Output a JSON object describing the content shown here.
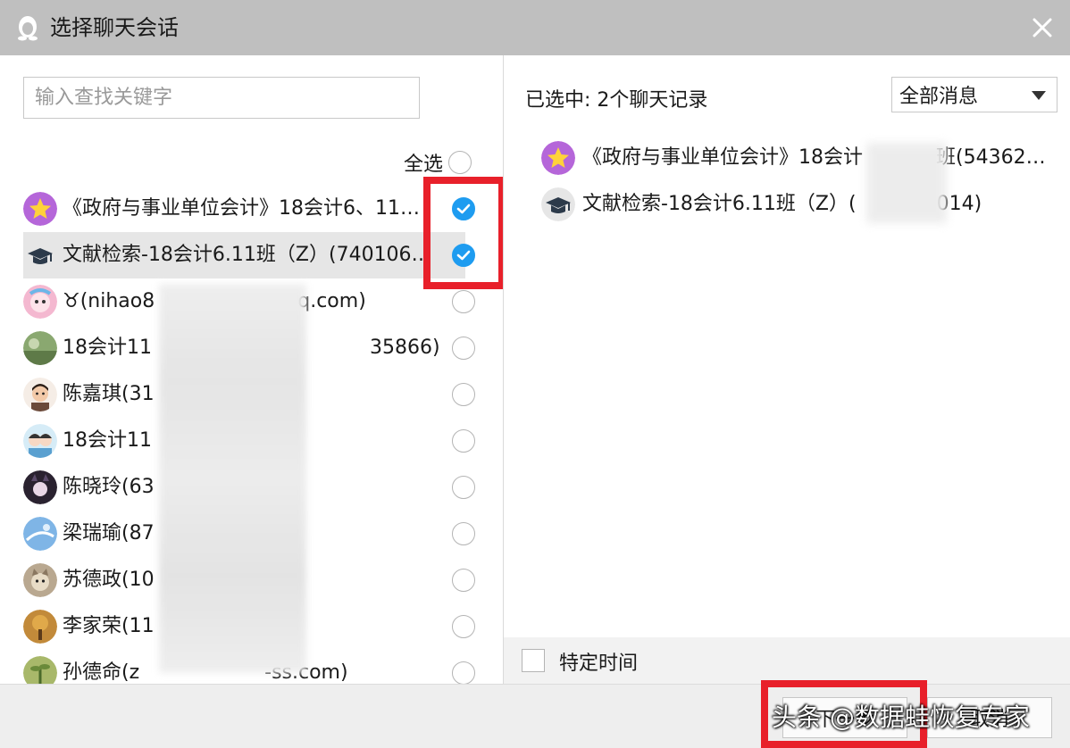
{
  "window": {
    "title": "选择聊天会话",
    "accent_color": "#1e9cf0",
    "highlight_color": "#e8202a"
  },
  "left": {
    "search_placeholder": "输入查找关键字",
    "select_all_label": "全选",
    "items": [
      {
        "label": "《政府与事业单位会计》18会计6、11…",
        "checked": true,
        "avatar": "star-group-avatar"
      },
      {
        "label": "文献检索-18会计6.11班（Z）(740106…",
        "checked": true,
        "avatar": "graduation-cap-avatar"
      },
      {
        "label": "♉(nihao8",
        "label_tail": "q.com)",
        "checked": false,
        "avatar": "cartoon-avatar"
      },
      {
        "label": "18会计11",
        "label_tail": "35866)",
        "checked": false,
        "avatar": "landscape-avatar"
      },
      {
        "label": "陈嘉琪(31",
        "checked": false,
        "avatar": "person-avatar"
      },
      {
        "label": "18会计11",
        "checked": false,
        "avatar": "couple-avatar"
      },
      {
        "label": "陈晓玲(63",
        "checked": false,
        "avatar": "anime-avatar"
      },
      {
        "label": "梁瑞瑜(87",
        "checked": false,
        "avatar": "sky-avatar"
      },
      {
        "label": "苏德政(10",
        "checked": false,
        "avatar": "cat-avatar"
      },
      {
        "label": "李家荣(11",
        "checked": false,
        "avatar": "tree-avatar"
      },
      {
        "label": "孙德命(z",
        "label_tail": "-ss.com)",
        "checked": false,
        "avatar": "plant-avatar"
      }
    ]
  },
  "right": {
    "selected_count": "已选中: 2个聊天记录",
    "filter_value": "全部消息",
    "selected_items": [
      {
        "label": "《政府与事业单位会计》18会计",
        "label_tail": "班(54362…",
        "avatar": "star-group-avatar"
      },
      {
        "label": "文献检索-18会计6.11班（Z）(",
        "label_tail": "014)",
        "avatar": "graduation-cap-avatar"
      }
    ],
    "specific_time_label": "特定时间"
  },
  "buttons": {
    "next": "下一步",
    "cancel": "取消"
  },
  "watermark": "头条 @数据蛙恢复专家"
}
